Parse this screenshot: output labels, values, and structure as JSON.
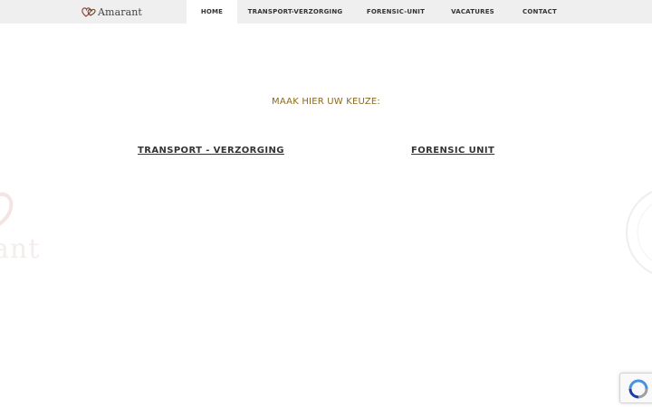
{
  "brand": {
    "name": "Amarant",
    "logo_icon": "hearts-logo-icon"
  },
  "nav": {
    "items": [
      {
        "label": "HOME",
        "active": true
      },
      {
        "label": "TRANSPORT-VERZORGING",
        "active": false
      },
      {
        "label": "FORENSIC-UNIT",
        "active": false
      },
      {
        "label": "VACATURES",
        "active": false
      },
      {
        "label": "CONTACT",
        "active": false
      }
    ]
  },
  "main": {
    "prompt": "MAAK HIER UW KEUZE:",
    "choices": [
      {
        "label": "TRANSPORT - VERZORGING"
      },
      {
        "label": "FORENSIC UNIT"
      }
    ]
  },
  "watermark": {
    "text": "ant"
  },
  "recaptcha": {
    "icon": "recaptcha-icon"
  },
  "colors": {
    "topbar": "#efefef",
    "prompt": "#8a6a1e",
    "link": "#333333",
    "logo_heart": "#a0413a"
  }
}
